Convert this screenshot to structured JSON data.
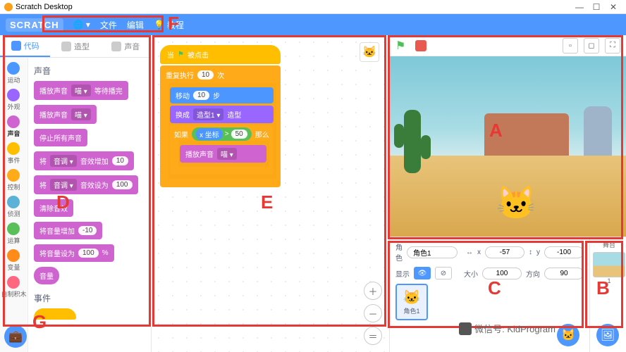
{
  "window": {
    "title": "Scratch Desktop"
  },
  "menubar": {
    "logo": "SCRATCH",
    "globe": "🌐 ▾",
    "file": "文件",
    "edit": "编辑",
    "tutorials_icon": "💡",
    "tutorials": "教程"
  },
  "tabs": {
    "code": "代码",
    "costumes": "造型",
    "sounds": "声音"
  },
  "categories": [
    {
      "name": "运动",
      "color": "#4c97ff"
    },
    {
      "name": "外观",
      "color": "#9966ff"
    },
    {
      "name": "声音",
      "color": "#cf63cf"
    },
    {
      "name": "事件",
      "color": "#ffbf00"
    },
    {
      "name": "控制",
      "color": "#ffab19"
    },
    {
      "name": "侦测",
      "color": "#5cb1d6"
    },
    {
      "name": "运算",
      "color": "#59c059"
    },
    {
      "name": "变量",
      "color": "#ff8c1a"
    },
    {
      "name": "自制积木",
      "color": "#ff6680"
    }
  ],
  "palette": {
    "section": "声音",
    "blocks": {
      "play_until_done_pre": "播放声音",
      "play_until_done_dd": "喵 ▾",
      "play_until_done_post": "等待播完",
      "play_pre": "播放声音",
      "play_dd": "喵 ▾",
      "stop_all": "停止所有声音",
      "change_effect_pre": "将",
      "change_effect_dd": "音调 ▾",
      "change_effect_mid": "音效增加",
      "change_effect_val": "10",
      "set_effect_pre": "将",
      "set_effect_dd": "音调 ▾",
      "set_effect_mid": "音效设为",
      "set_effect_val": "100",
      "clear_effects": "清除音效",
      "change_volume_pre": "将音量增加",
      "change_volume_val": "-10",
      "set_volume_pre": "将音量设为",
      "set_volume_val": "100",
      "set_volume_post": "%",
      "volume_reporter": "音量"
    },
    "section2": "事件"
  },
  "script": {
    "hat_pre": "当",
    "hat_flag": "⚑",
    "hat_post": "被点击",
    "repeat_pre": "重复执行",
    "repeat_val": "10",
    "repeat_post": "次",
    "move_pre": "移动",
    "move_val": "10",
    "move_post": "步",
    "next_pre": "换成",
    "next_dd": "造型1 ▾",
    "next_post": "造型",
    "if_pre": "如果",
    "if_post": "那么",
    "bool_var": "x 坐标",
    "bool_op": ">",
    "bool_val": "50",
    "psound_pre": "播放声音",
    "psound_dd": "喵 ▾"
  },
  "sprite_info": {
    "name_label": "角色",
    "name_value": "角色1",
    "x_label": "x",
    "x_value": "-57",
    "y_label": "y",
    "y_value": "-100",
    "show_label": "显示",
    "size_label": "大小",
    "size_value": "100",
    "dir_label": "方向",
    "dir_value": "90",
    "card_label": "角色1"
  },
  "stage_panel": {
    "label": "舞台",
    "count": "1"
  },
  "labels": {
    "A": "A",
    "B": "B",
    "C": "C",
    "D": "D",
    "E": "E",
    "F": "F",
    "G": "G"
  },
  "watermark": {
    "text": "微信号: KidProgram"
  }
}
